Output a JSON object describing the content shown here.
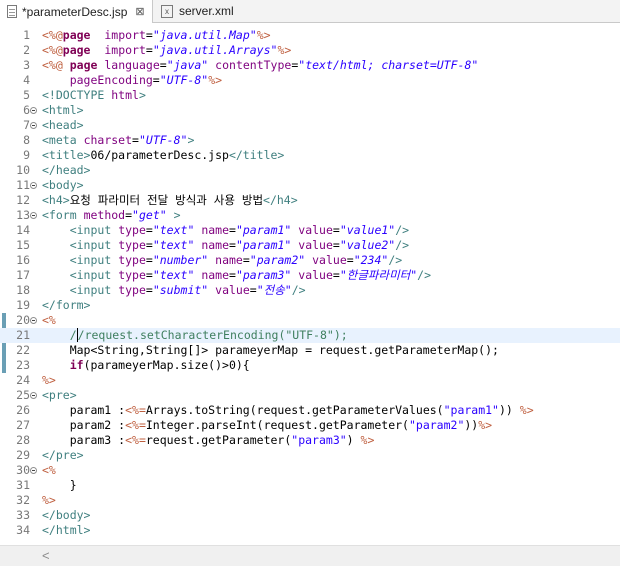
{
  "tabs": [
    {
      "title": "*parameterDesc.jsp",
      "close": "⊠",
      "icon": "jsp-file-icon"
    },
    {
      "title": "server.xml",
      "icon": "xml-file-icon"
    }
  ],
  "scroll_left": "<",
  "lines": [
    {
      "n": "1",
      "fold": false,
      "tokens": [
        [
          "d",
          "<%@"
        ],
        [
          "k",
          "page"
        ],
        [
          "",
          "  "
        ],
        [
          "a",
          "import"
        ],
        [
          "",
          "="
        ],
        [
          "v",
          "\"java.util.Map\""
        ],
        [
          "d",
          "%>"
        ]
      ]
    },
    {
      "n": "2",
      "fold": false,
      "tokens": [
        [
          "d",
          "<%@"
        ],
        [
          "k",
          "page"
        ],
        [
          "",
          "  "
        ],
        [
          "a",
          "import"
        ],
        [
          "",
          "="
        ],
        [
          "v",
          "\"java.util.Arrays\""
        ],
        [
          "d",
          "%>"
        ]
      ]
    },
    {
      "n": "3",
      "fold": false,
      "tokens": [
        [
          "d",
          "<%@"
        ],
        [
          "",
          " "
        ],
        [
          "k",
          "page"
        ],
        [
          "",
          " "
        ],
        [
          "a",
          "language"
        ],
        [
          "",
          "="
        ],
        [
          "v",
          "\"java\""
        ],
        [
          "",
          " "
        ],
        [
          "a",
          "contentType"
        ],
        [
          "",
          "="
        ],
        [
          "v",
          "\"text/html; charset=UTF-8\""
        ]
      ]
    },
    {
      "n": "4",
      "fold": false,
      "tokens": [
        [
          "",
          "    "
        ],
        [
          "a",
          "pageEncoding"
        ],
        [
          "",
          "="
        ],
        [
          "v",
          "\"UTF-8\""
        ],
        [
          "d",
          "%>"
        ]
      ]
    },
    {
      "n": "5",
      "fold": false,
      "tokens": [
        [
          "t",
          "<!DOCTYPE"
        ],
        [
          "",
          " "
        ],
        [
          "a",
          "html"
        ],
        [
          "t",
          ">"
        ]
      ]
    },
    {
      "n": "6",
      "fold": true,
      "tokens": [
        [
          "t",
          "<html>"
        ]
      ]
    },
    {
      "n": "7",
      "fold": true,
      "tokens": [
        [
          "t",
          "<head>"
        ]
      ]
    },
    {
      "n": "8",
      "fold": false,
      "tokens": [
        [
          "t",
          "<meta"
        ],
        [
          "",
          " "
        ],
        [
          "a",
          "charset"
        ],
        [
          "",
          "="
        ],
        [
          "v",
          "\"UTF-8\""
        ],
        [
          "t",
          ">"
        ]
      ]
    },
    {
      "n": "9",
      "fold": false,
      "tokens": [
        [
          "t",
          "<title>"
        ],
        [
          "",
          "06/parameterDesc.jsp"
        ],
        [
          "t",
          "</title>"
        ]
      ]
    },
    {
      "n": "10",
      "fold": false,
      "tokens": [
        [
          "t",
          "</head>"
        ]
      ]
    },
    {
      "n": "11",
      "fold": true,
      "tokens": [
        [
          "t",
          "<body>"
        ]
      ]
    },
    {
      "n": "12",
      "fold": false,
      "tokens": [
        [
          "t",
          "<h4>"
        ],
        [
          "",
          "요청 파라미터 전달 방식과 사용 방법"
        ],
        [
          "t",
          "</h4>"
        ]
      ]
    },
    {
      "n": "13",
      "fold": true,
      "tokens": [
        [
          "t",
          "<form"
        ],
        [
          "",
          " "
        ],
        [
          "a",
          "method"
        ],
        [
          "",
          "="
        ],
        [
          "v",
          "\"get\""
        ],
        [
          "",
          " "
        ],
        [
          "t",
          ">"
        ]
      ]
    },
    {
      "n": "14",
      "fold": false,
      "tokens": [
        [
          "",
          "    "
        ],
        [
          "t",
          "<input"
        ],
        [
          "",
          " "
        ],
        [
          "a",
          "type"
        ],
        [
          "",
          "="
        ],
        [
          "v",
          "\"text\""
        ],
        [
          "",
          " "
        ],
        [
          "a",
          "name"
        ],
        [
          "",
          "="
        ],
        [
          "v",
          "\"param1\""
        ],
        [
          "",
          " "
        ],
        [
          "a",
          "value"
        ],
        [
          "",
          "="
        ],
        [
          "v",
          "\"value1\""
        ],
        [
          "t",
          "/>"
        ]
      ]
    },
    {
      "n": "15",
      "fold": false,
      "tokens": [
        [
          "",
          "    "
        ],
        [
          "t",
          "<input"
        ],
        [
          "",
          " "
        ],
        [
          "a",
          "type"
        ],
        [
          "",
          "="
        ],
        [
          "v",
          "\"text\""
        ],
        [
          "",
          " "
        ],
        [
          "a",
          "name"
        ],
        [
          "",
          "="
        ],
        [
          "v",
          "\"param1\""
        ],
        [
          "",
          " "
        ],
        [
          "a",
          "value"
        ],
        [
          "",
          "="
        ],
        [
          "v",
          "\"value2\""
        ],
        [
          "t",
          "/>"
        ]
      ]
    },
    {
      "n": "16",
      "fold": false,
      "tokens": [
        [
          "",
          "    "
        ],
        [
          "t",
          "<input"
        ],
        [
          "",
          " "
        ],
        [
          "a",
          "type"
        ],
        [
          "",
          "="
        ],
        [
          "v",
          "\"number\""
        ],
        [
          "",
          " "
        ],
        [
          "a",
          "name"
        ],
        [
          "",
          "="
        ],
        [
          "v",
          "\"param2\""
        ],
        [
          "",
          " "
        ],
        [
          "a",
          "value"
        ],
        [
          "",
          "="
        ],
        [
          "v",
          "\"234\""
        ],
        [
          "t",
          "/>"
        ]
      ]
    },
    {
      "n": "17",
      "fold": false,
      "tokens": [
        [
          "",
          "    "
        ],
        [
          "t",
          "<input"
        ],
        [
          "",
          " "
        ],
        [
          "a",
          "type"
        ],
        [
          "",
          "="
        ],
        [
          "v",
          "\"text\""
        ],
        [
          "",
          " "
        ],
        [
          "a",
          "name"
        ],
        [
          "",
          "="
        ],
        [
          "v",
          "\"param3\""
        ],
        [
          "",
          " "
        ],
        [
          "a",
          "value"
        ],
        [
          "",
          "="
        ],
        [
          "v",
          "\"한글파라미터\""
        ],
        [
          "t",
          "/>"
        ]
      ]
    },
    {
      "n": "18",
      "fold": false,
      "tokens": [
        [
          "",
          "    "
        ],
        [
          "t",
          "<input"
        ],
        [
          "",
          " "
        ],
        [
          "a",
          "type"
        ],
        [
          "",
          "="
        ],
        [
          "v",
          "\"submit\""
        ],
        [
          "",
          " "
        ],
        [
          "a",
          "value"
        ],
        [
          "",
          "="
        ],
        [
          "v",
          "\"전송\""
        ],
        [
          "t",
          "/>"
        ]
      ]
    },
    {
      "n": "19",
      "fold": false,
      "tokens": [
        [
          "t",
          "</form>"
        ]
      ]
    },
    {
      "n": "20",
      "fold": true,
      "tokens": [
        [
          "d",
          "<%"
        ]
      ]
    },
    {
      "n": "21",
      "fold": false,
      "current": true,
      "tokens": [
        [
          "",
          "    "
        ],
        [
          "c",
          "/"
        ],
        [
          "caret",
          "/"
        ],
        [
          "c",
          "request.setCharacterEncoding(\"UTF-8\");"
        ]
      ]
    },
    {
      "n": "22",
      "fold": false,
      "tokens": [
        [
          "",
          "    Map<String,String[]> parameyerMap = request.getParameterMap();"
        ]
      ]
    },
    {
      "n": "23",
      "fold": false,
      "tokens": [
        [
          "",
          "    "
        ],
        [
          "k",
          "if"
        ],
        [
          "",
          "(parameyerMap.size()>0){"
        ]
      ]
    },
    {
      "n": "24",
      "fold": false,
      "tokens": [
        [
          "d",
          "%>"
        ]
      ]
    },
    {
      "n": "25",
      "fold": true,
      "tokens": [
        [
          "t",
          "<pre>"
        ]
      ]
    },
    {
      "n": "26",
      "fold": false,
      "tokens": [
        [
          "",
          "    param1 :"
        ],
        [
          "d",
          "<%="
        ],
        [
          "",
          "Arrays.toString(request.getParameterValues("
        ],
        [
          "s",
          "\"param1\""
        ],
        [
          "",
          ")) "
        ],
        [
          "d",
          "%>"
        ]
      ]
    },
    {
      "n": "27",
      "fold": false,
      "tokens": [
        [
          "",
          "    param2 :"
        ],
        [
          "d",
          "<%="
        ],
        [
          "",
          "Integer.parseInt(request.getParameter("
        ],
        [
          "s",
          "\"param2\""
        ],
        [
          "",
          "))"
        ],
        [
          "d",
          "%>"
        ]
      ]
    },
    {
      "n": "28",
      "fold": false,
      "tokens": [
        [
          "",
          "    param3 :"
        ],
        [
          "d",
          "<%="
        ],
        [
          "",
          "request.getParameter("
        ],
        [
          "s",
          "\"param3\""
        ],
        [
          "",
          ") "
        ],
        [
          "d",
          "%>"
        ]
      ]
    },
    {
      "n": "29",
      "fold": false,
      "tokens": [
        [
          "t",
          "</pre>"
        ]
      ]
    },
    {
      "n": "30",
      "fold": true,
      "tokens": [
        [
          "d",
          "<%"
        ]
      ]
    },
    {
      "n": "31",
      "fold": false,
      "tokens": [
        [
          "",
          "    }"
        ]
      ]
    },
    {
      "n": "32",
      "fold": false,
      "tokens": [
        [
          "d",
          "%>"
        ]
      ]
    },
    {
      "n": "33",
      "fold": false,
      "tokens": [
        [
          "t",
          "</body>"
        ]
      ]
    },
    {
      "n": "34",
      "fold": false,
      "tokens": [
        [
          "t",
          "</html>"
        ]
      ]
    }
  ]
}
